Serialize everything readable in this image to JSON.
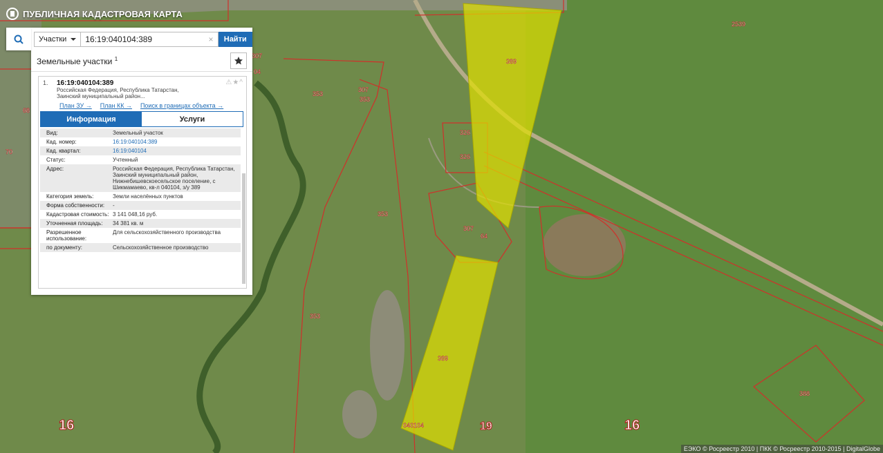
{
  "app": {
    "title": "ПУБЛИЧНАЯ КАДАСТРОВАЯ КАРТА"
  },
  "search": {
    "type_label": "Участки",
    "query": "16:19:040104:389",
    "clear": "×",
    "find_label": "Найти"
  },
  "results": {
    "heading": "Земельные участки",
    "count": "1",
    "item": {
      "index": "1.",
      "cad_number": "16:19:040104:389",
      "address_line1": "Российская Федерация, Республика Татарстан,",
      "address_line2": "Заинский муниципальный район...",
      "links": [
        "План ЗУ →",
        "План КК →",
        "Поиск в границах объекта →"
      ],
      "tabs": [
        "Информация",
        "Услуги"
      ],
      "attributes": [
        {
          "k": "Вид:",
          "v": "Земельный участок"
        },
        {
          "k": "Кад. номер:",
          "v": "16:19:040104:389"
        },
        {
          "k": "Кад. квартал:",
          "v": "16:19:040104"
        },
        {
          "k": "Статус:",
          "v": "Учтенный"
        },
        {
          "k": "Адрес:",
          "v": "Российская Федерация, Республика Татарстан, Заинский муниципальный район, Нижнебишевскоесельское поселение, с Шикмамаево, кв-л 040104, з/у 389"
        },
        {
          "k": "Категория земель:",
          "v": "Земли населённых пунктов"
        },
        {
          "k": "Форма собственности:",
          "v": "-"
        },
        {
          "k": "Кадастровая стоимость:",
          "v": "3 141 048,16 руб."
        },
        {
          "k": "Уточненная площадь:",
          "v": "34 381 кв. м"
        },
        {
          "k": "Разрешенное использование:",
          "v": "Для сельскохозяйственного производства"
        },
        {
          "k": "по документу:",
          "v": "Сельскохозяйственное производство"
        }
      ]
    }
  },
  "map_labels": {
    "l2539": "2539",
    "l389a": "389",
    "l389b": "389",
    "l307a": "307",
    "l307b": "307",
    "l307c": "307",
    "l353a": "353",
    "l353b": "353",
    "l353c": "353",
    "l353d": "353",
    "l326a": "326",
    "l326b": "326",
    "l64": "64",
    "l68": "68",
    "l70": "70",
    "l04": "04",
    "l388": "388",
    "l040104": "040104",
    "z16a": "16",
    "z19": "19",
    "z16b": "16"
  },
  "copyright": "ЕЭКО © Росреестр 2010 | ПКК © Росреестр 2010-2015 | DigitalGlobe"
}
